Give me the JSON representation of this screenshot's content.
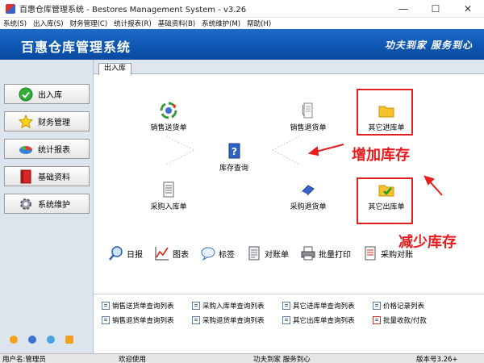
{
  "window": {
    "title": "百惠仓库管理系统 - Bestores Management System - v3.26",
    "min_glyph": "—",
    "max_glyph": "☐",
    "close_glyph": "✕"
  },
  "menu": [
    "系统(S)",
    "出入库(S)",
    "财务管理(C)",
    "统计报表(R)",
    "基础资料(B)",
    "系统维护(M)",
    "帮助(H)"
  ],
  "banner": {
    "title": "百惠仓库管理系统",
    "slogan": "功夫到家 服务到心"
  },
  "sidebar": {
    "items": [
      {
        "label": "出入库",
        "icon": "check-circle-icon"
      },
      {
        "label": "财务管理",
        "icon": "star-icon"
      },
      {
        "label": "统计报表",
        "icon": "pie-chart-icon"
      },
      {
        "label": "基础资料",
        "icon": "book-icon"
      },
      {
        "label": "系统维护",
        "icon": "gear-icon"
      }
    ]
  },
  "tab": {
    "label": "出入库"
  },
  "flow": {
    "sales_out": "销售送货单",
    "sales_return": "销售退货单",
    "other_in": "其它进库单",
    "inventory": "库存查询",
    "purchase_in": "采购入库单",
    "purchase_return": "采购退货单",
    "other_out": "其它出库单"
  },
  "annotations": {
    "increase": "增加库存",
    "decrease": "减少库存"
  },
  "tools": [
    "日报",
    "图表",
    "标签",
    "对账单",
    "批量打印",
    "采购对账"
  ],
  "queries": [
    "销售送货单查询列表",
    "采购入库单查询列表",
    "其它进库单查询列表",
    "价格记录列表",
    "销售退货单查询列表",
    "采购退货单查询列表",
    "其它出库单查询列表",
    "批量收款/付款"
  ],
  "status": {
    "user": "用户名:管理员",
    "welcome": "欢迎使用",
    "motto": "功夫到家 服务到心",
    "version": "版本号3.26+"
  }
}
